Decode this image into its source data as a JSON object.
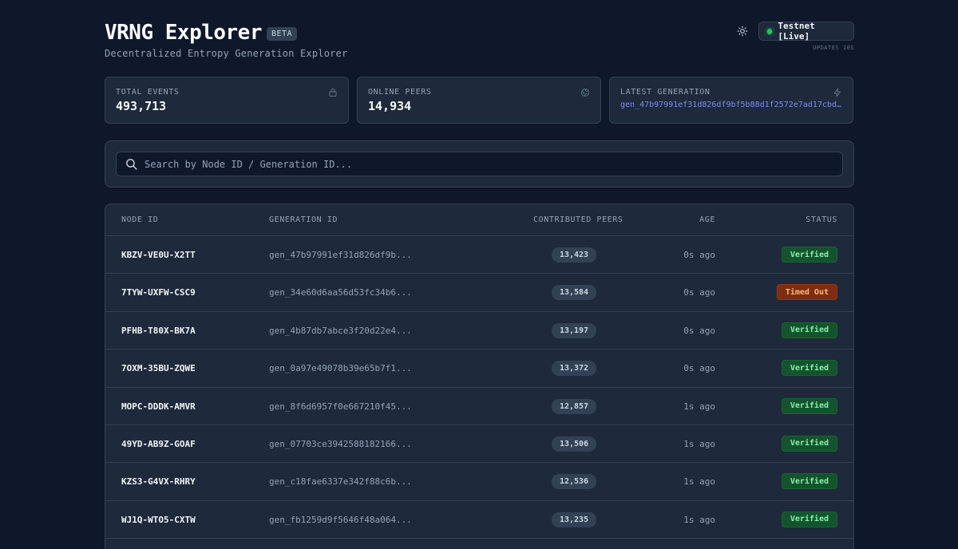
{
  "header": {
    "title": "VRNG Explorer",
    "badge": "BETA",
    "subtitle": "Decentralized Entropy Generation Explorer",
    "network_label": "Testnet [Live]",
    "updates": "UPDATES 10S",
    "theme_icon": "sun-icon"
  },
  "stats": [
    {
      "label": "TOTAL EVENTS",
      "value": "493,713",
      "icon": "lock-icon"
    },
    {
      "label": "ONLINE PEERS",
      "value": "14,934",
      "icon": "globe-icon"
    },
    {
      "label": "LATEST GENERATION",
      "value": "gen_47b97991ef31d826df9bf5b88d1f2572e7ad17cbd…",
      "icon": "bolt-icon"
    }
  ],
  "search": {
    "placeholder": "Search by Node ID / Generation ID..."
  },
  "table": {
    "headers": [
      "NODE ID",
      "GENERATION ID",
      "CONTRIBUTED PEERS",
      "AGE",
      "STATUS"
    ],
    "rows": [
      {
        "node": "KBZV-VE0U-X2TT",
        "gen": "gen_47b97991ef31d826df9b...",
        "peers": "13,423",
        "age": "0s ago",
        "status": "Verified"
      },
      {
        "node": "7TYW-UXFW-CSC9",
        "gen": "gen_34e60d6aa56d53fc34b6...",
        "peers": "13,584",
        "age": "0s ago",
        "status": "Timed Out"
      },
      {
        "node": "PFHB-T80X-BK7A",
        "gen": "gen_4b87db7abce3f20d22e4...",
        "peers": "13,197",
        "age": "0s ago",
        "status": "Verified"
      },
      {
        "node": "7OXM-35BU-ZQWE",
        "gen": "gen_0a97e49078b39e65b7f1...",
        "peers": "13,372",
        "age": "0s ago",
        "status": "Verified"
      },
      {
        "node": "MOPC-DDDK-AMVR",
        "gen": "gen_8f6d6957f0e667210f45...",
        "peers": "12,857",
        "age": "1s ago",
        "status": "Verified"
      },
      {
        "node": "49YD-AB9Z-GOAF",
        "gen": "gen_07703ce3942588182166...",
        "peers": "13,506",
        "age": "1s ago",
        "status": "Verified"
      },
      {
        "node": "KZS3-G4VX-RHRY",
        "gen": "gen_c18fae6337e342f88c6b...",
        "peers": "12,536",
        "age": "1s ago",
        "status": "Verified"
      },
      {
        "node": "WJ1Q-WTO5-CXTW",
        "gen": "gen_fb1259d9f5646f48a064...",
        "peers": "13,235",
        "age": "1s ago",
        "status": "Verified"
      }
    ]
  },
  "colors": {
    "background": "#0f172a",
    "panel": "#1e293b",
    "accent_link": "#818cf8",
    "live_dot": "#22c55e",
    "verified": "#86efac",
    "timed_out": "#fdba74"
  }
}
